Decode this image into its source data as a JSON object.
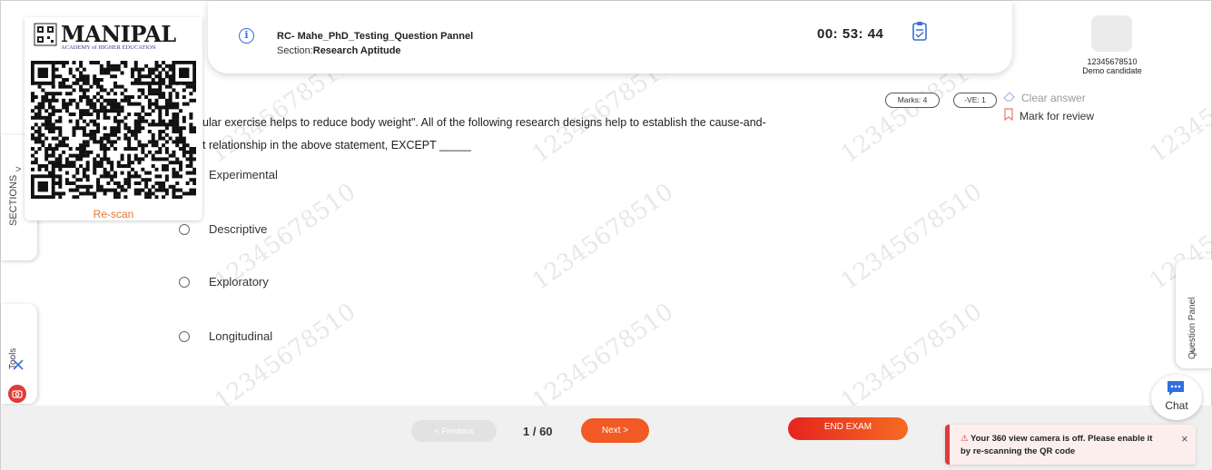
{
  "header": {
    "exam_title": "RC- Mahe_PhD_Testing_Question Pannel",
    "section_label": "Section:",
    "section_name": "Research Aptitude",
    "timer": "00: 53: 44"
  },
  "candidate": {
    "id": "12345678510",
    "name": "Demo candidate"
  },
  "brand": {
    "name": "MANIPAL",
    "subtitle": "ACADEMY of HIGHER EDUCATION",
    "rescan_label": "Re-scan"
  },
  "sidebar": {
    "sections_label": "SECTIONS",
    "tools_label": "Tools",
    "question_panel_label": "Question Panel"
  },
  "question": {
    "text_line1": "ular exercise helps to reduce body weight\". All of the following research designs help to establish the cause-and-",
    "text_line2": "t relationship in the above statement, EXCEPT _____",
    "marks": "Marks: 4",
    "negative": "-VE: 1",
    "clear_answer": "Clear answer",
    "mark_for_review": "Mark for review",
    "options": [
      {
        "label": "Experimental"
      },
      {
        "label": "Descriptive"
      },
      {
        "label": "Exploratory"
      },
      {
        "label": "Longitudinal"
      }
    ]
  },
  "footer": {
    "previous_label": "< Previous",
    "page_indicator": "1 / 60",
    "next_label": "Next  >",
    "end_exam_label": "END EXAM"
  },
  "chat": {
    "label": "Chat"
  },
  "toast": {
    "message": "Your 360 view camera is off. Please enable it by re-scanning the QR code",
    "close": "×"
  },
  "watermark": "12345678510",
  "colors": {
    "accent": "#f15a24",
    "danger": "#e03a3a",
    "info": "#3a6fd8",
    "rescan": "#e8762b"
  }
}
